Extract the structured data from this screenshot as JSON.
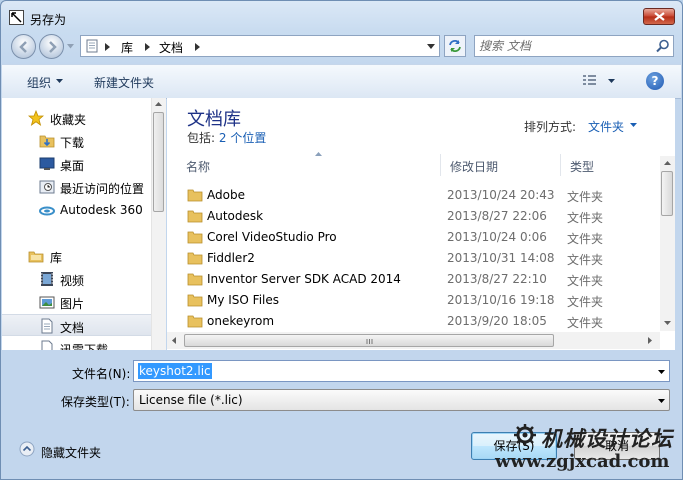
{
  "window": {
    "title": "另存为"
  },
  "address": {
    "crumbs": [
      "库",
      "文档"
    ]
  },
  "search": {
    "placeholder": "搜索 文档"
  },
  "toolbar": {
    "organize_label": "组织",
    "new_folder_label": "新建文件夹"
  },
  "nav": {
    "items": [
      {
        "label": "收藏夹",
        "icon": "star-icon"
      },
      {
        "label": "下载",
        "icon": "download-folder-icon"
      },
      {
        "label": "桌面",
        "icon": "desktop-icon"
      },
      {
        "label": "最近访问的位置",
        "icon": "recent-places-icon"
      },
      {
        "label": "Autodesk 360",
        "icon": "cloud-icon"
      },
      {
        "label": "库",
        "icon": "library-icon"
      },
      {
        "label": "视频",
        "icon": "video-icon"
      },
      {
        "label": "图片",
        "icon": "pictures-icon"
      },
      {
        "label": "文档",
        "icon": "document-icon"
      },
      {
        "label": "迅雷下载",
        "icon": "thunder-download-icon"
      }
    ]
  },
  "library": {
    "title": "文档库",
    "includes_prefix": "包括:",
    "includes_link": "2 个位置",
    "arrange_label": "排列方式:",
    "arrange_value": "文件夹"
  },
  "columns": {
    "name": "名称",
    "modified": "修改日期",
    "type": "类型"
  },
  "files": [
    {
      "name": "Adobe",
      "modified": "2013/10/24 20:43",
      "type": "文件夹"
    },
    {
      "name": "Autodesk",
      "modified": "2013/8/27 22:06",
      "type": "文件夹"
    },
    {
      "name": "Corel VideoStudio Pro",
      "modified": "2013/10/24 0:06",
      "type": "文件夹"
    },
    {
      "name": "Fiddler2",
      "modified": "2013/10/31 14:08",
      "type": "文件夹"
    },
    {
      "name": "Inventor Server SDK ACAD 2014",
      "modified": "2013/8/27 22:10",
      "type": "文件夹"
    },
    {
      "name": "My ISO Files",
      "modified": "2013/10/16 19:18",
      "type": "文件夹"
    },
    {
      "name": "onekeyrom",
      "modified": "2013/9/20 18:05",
      "type": "文件夹"
    }
  ],
  "form": {
    "filename_label": "文件名(N):",
    "filename_value": "keyshot2.lic",
    "filetype_label": "保存类型(T):",
    "filetype_value": "License file (*.lic)"
  },
  "footer": {
    "hide_folders_label": "隐藏文件夹",
    "save_label": "保存(S)",
    "cancel_label": "取消"
  },
  "watermark": {
    "title": "机械设计论坛",
    "url": "www.zgjxcad.com"
  },
  "colors": {
    "accent": "#1e3287",
    "link": "#1a5fb4",
    "selection": "#3399ff"
  }
}
